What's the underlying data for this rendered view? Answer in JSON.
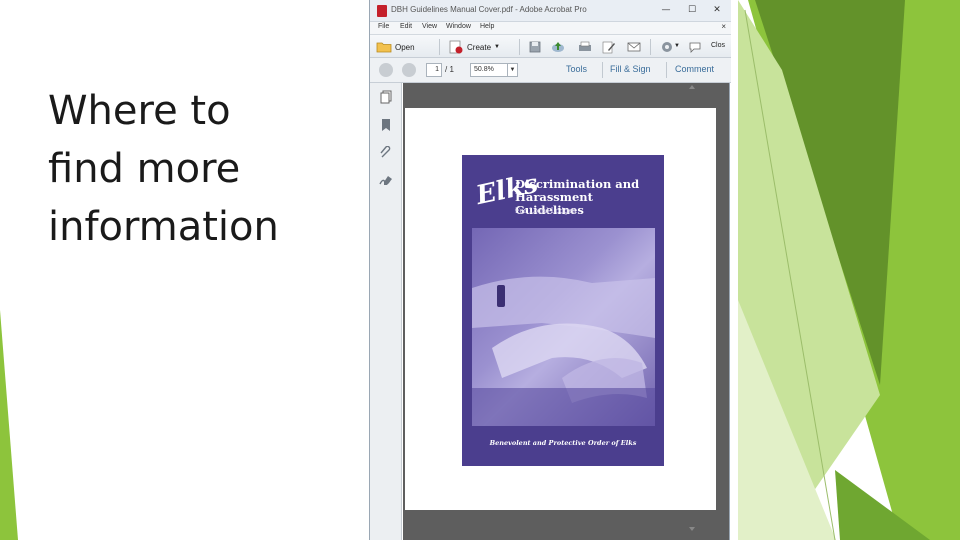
{
  "slide": {
    "title": "Where to\nfind more\ninformation",
    "theme_colors": {
      "green_dark": "#5c8a27",
      "green_mid": "#8dc43c",
      "green_light": "#c8e39b",
      "green_pale": "#e2f0c8"
    }
  },
  "window": {
    "title": "DBH Guidelines Manual Cover.pdf - Adobe Acrobat Pro",
    "controls": {
      "minimize": "—",
      "maximize": "☐",
      "close": "✕"
    }
  },
  "menubar": {
    "items": [
      "File",
      "Edit",
      "View",
      "Window",
      "Help"
    ],
    "close": "×"
  },
  "toolbar": {
    "open_label": "Open",
    "create_label": "Create",
    "close_label": "Clos"
  },
  "nav": {
    "page_current": "1",
    "page_total": "/ 1",
    "zoom": "50.8%",
    "tools_label": "Tools",
    "fill_sign_label": "Fill & Sign",
    "comment_label": "Comment"
  },
  "document": {
    "logo_text": "Elks",
    "title": "Discrimination and\nHarassment Guidelines",
    "subtitle": "For Local Lodges",
    "footer": "Benevolent and Protective Order of Elks",
    "cover_color": "#4b3e8e"
  },
  "icons": {
    "sidebar": [
      "pages-icon",
      "bookmark-icon",
      "attachment-icon",
      "signature-icon"
    ],
    "toolbar": [
      "folder-icon",
      "create-pdf-icon",
      "save-icon",
      "upload-icon",
      "print-icon",
      "edit-icon",
      "email-icon",
      "settings-icon",
      "page-prev-icon",
      "page-next-icon"
    ]
  }
}
